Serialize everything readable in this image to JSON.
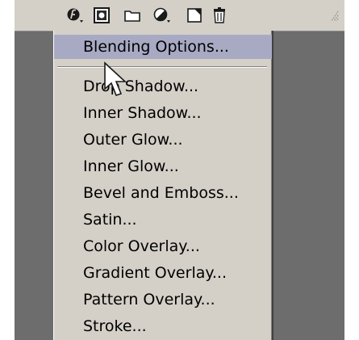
{
  "toolbar": {
    "buttons": [
      {
        "icon": "add-layer-style-icon",
        "has_dropdown": true
      },
      {
        "icon": "add-mask-icon",
        "has_dropdown": false
      },
      {
        "icon": "new-group-folder-icon",
        "has_dropdown": false
      },
      {
        "icon": "adjustment-layer-icon",
        "has_dropdown": true
      },
      {
        "icon": "new-layer-icon",
        "has_dropdown": false
      },
      {
        "icon": "trash-icon",
        "has_dropdown": false
      }
    ]
  },
  "menu": {
    "highlight_color": "#a8aac4",
    "items": [
      {
        "label": "Blending Options...",
        "highlighted": true
      },
      {
        "label": "Drop Shadow..."
      },
      {
        "label": "Inner Shadow..."
      },
      {
        "label": "Outer Glow..."
      },
      {
        "label": "Inner Glow..."
      },
      {
        "label": "Bevel and Emboss..."
      },
      {
        "label": "Satin..."
      },
      {
        "label": "Color Overlay..."
      },
      {
        "label": "Gradient Overlay..."
      },
      {
        "label": "Pattern Overlay..."
      },
      {
        "label": "Stroke..."
      }
    ]
  }
}
